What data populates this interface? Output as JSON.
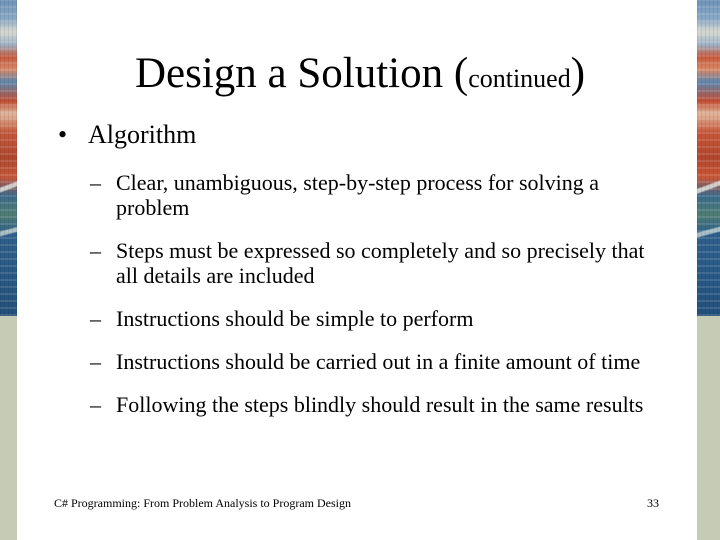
{
  "slide": {
    "title_main": "Design a Solution",
    "title_open_paren": "(",
    "title_sub": "continued",
    "title_close_paren": ")",
    "bullet": {
      "marker": "•",
      "label": "Algorithm",
      "sub_marker": "–",
      "items": [
        "Clear, unambiguous, step-by-step process for solving a problem",
        "Steps must be expressed so completely and so precisely that all details are included",
        "Instructions should be simple to perform",
        "Instructions should be carried out in a finite amount of time",
        "Following the steps blindly should result in the same results"
      ]
    },
    "footer_text": "C# Programming: From Problem Analysis to Program Design",
    "page_number": "33"
  },
  "colors": {
    "background": "#ffffff",
    "side_strip": "#c6cbb5",
    "text": "#000000"
  }
}
